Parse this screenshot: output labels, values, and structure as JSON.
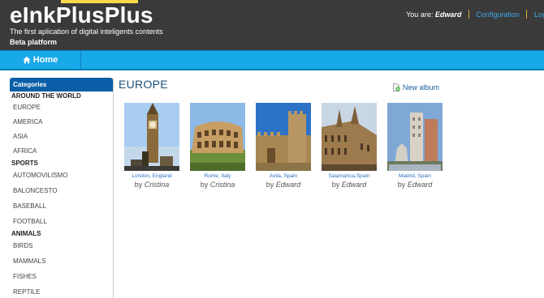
{
  "header": {
    "brand": "eInkPlusPlus",
    "tagline": "The first aplication of digital inteligents contents",
    "platform": "Beta platform",
    "user_prefix": "You are:",
    "username": "Edward",
    "config_link": "Configuration",
    "logout_link": "Logo"
  },
  "nav": {
    "home_label": "Home"
  },
  "sidebar": {
    "title": "Categories",
    "groups": [
      {
        "label": "AROUND THE WORLD",
        "items": [
          "EUROPE",
          "AMERICA",
          "ASIA",
          "AFRICA"
        ]
      },
      {
        "label": "SPORTS",
        "items": [
          "AUTOMOVILISMO",
          "BALONCESTO",
          "BASEBALL",
          "FOOTBALL"
        ]
      },
      {
        "label": "ANIMALS",
        "items": [
          "BIRDS",
          "MAMMALS",
          "FISHES",
          "REPTILE"
        ]
      }
    ]
  },
  "main": {
    "title": "EUROPE",
    "new_album": "New album",
    "by_prefix": "by",
    "albums": [
      {
        "caption": "London, England",
        "author": "Cristina"
      },
      {
        "caption": "Rome, Italy",
        "author": "Cristina"
      },
      {
        "caption": "Avila, Spain",
        "author": "Edward"
      },
      {
        "caption": "Salamanca,Spain",
        "author": "Edward"
      },
      {
        "caption": "Madrid, Spain",
        "author": "Edward"
      }
    ]
  },
  "colors": {
    "header_bg": "#3a3a3a",
    "nav_bg": "#17a9e8",
    "sidebar_title_bg": "#0b5fa8",
    "link": "#2a6fc0"
  }
}
